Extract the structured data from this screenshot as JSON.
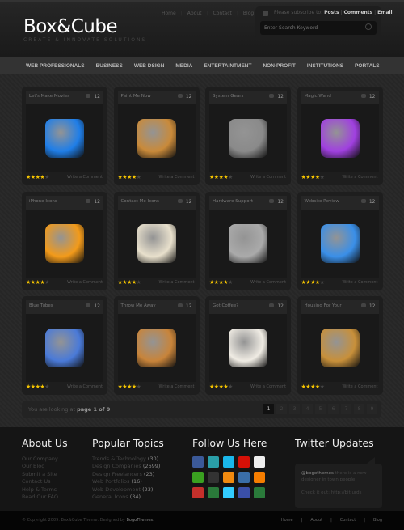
{
  "brand": {
    "name": "Box&Cube",
    "tagline": "CREATE & INNOVATE SOLUTIONS"
  },
  "top_links": [
    "Home",
    "About",
    "Contact",
    "Blog"
  ],
  "subscribe": {
    "text": "Please subscribe to:",
    "posts": "Posts",
    "comments": "Comments",
    "email": "Email",
    "icon": "rss-icon"
  },
  "search": {
    "placeholder": "Enter Search Keyword",
    "icon": "search-icon"
  },
  "nav": [
    "WEB PROFESSIONALS",
    "BUSINESS",
    "WEB DSIGN",
    "MEDIA",
    "ENTERTAINTMENT",
    "NON-PROFIT",
    "INSTITUTIONS",
    "PORTALS"
  ],
  "cards": [
    {
      "title": "Let's Make Movies",
      "comments": "12",
      "rating": 4,
      "link": "Write a Comment",
      "icon": "clapperboard-icon",
      "color": "#1f7ee8"
    },
    {
      "title": "Paint Me Now",
      "comments": "12",
      "rating": 4,
      "link": "Write a Comment",
      "icon": "paint-brush-icon",
      "color": "#c98a3a"
    },
    {
      "title": "System Gears",
      "comments": "12",
      "rating": 4,
      "link": "Write a Comment",
      "icon": "gear-icon",
      "color": "#8a8a8a"
    },
    {
      "title": "Magic Wand",
      "comments": "12",
      "rating": 4,
      "link": "Write a Comment",
      "icon": "magic-wand-icon",
      "color": "#a040e0"
    },
    {
      "title": "iPhone Icons",
      "comments": "12",
      "rating": 4,
      "link": "Write a Comment",
      "icon": "pen-tool-icon",
      "color": "#f29a1a"
    },
    {
      "title": "Contact Me Icons",
      "comments": "12",
      "rating": 4,
      "link": "Write a Comment",
      "icon": "envelope-pen-icon",
      "color": "#e8e0cc"
    },
    {
      "title": "Hardware Support",
      "comments": "12",
      "rating": 4,
      "link": "Write a Comment",
      "icon": "circuit-board-icon",
      "color": "#aaaaaa"
    },
    {
      "title": "Website Review",
      "comments": "12",
      "rating": 4,
      "link": "Write a Comment",
      "icon": "lens-icon",
      "color": "#3a8fe8"
    },
    {
      "title": "Blue Tubes",
      "comments": "12",
      "rating": 4,
      "link": "Write a Comment",
      "icon": "tv-icon",
      "color": "#4a7ad8"
    },
    {
      "title": "Throw Me Away",
      "comments": "12",
      "rating": 4,
      "link": "Write a Comment",
      "icon": "trash-box-icon",
      "color": "#c8843a"
    },
    {
      "title": "Got Coffee?",
      "comments": "12",
      "rating": 4,
      "link": "Write a Comment",
      "icon": "coffee-cup-icon",
      "color": "#f0ece4"
    },
    {
      "title": "Housing For Your",
      "comments": "12",
      "rating": 4,
      "link": "Write a Comment",
      "icon": "windmill-icon",
      "color": "#c8903a"
    }
  ],
  "pager": {
    "text": "You are looking at",
    "current": "page 1 of 9",
    "pages": [
      "1",
      "2",
      "3",
      "4",
      "5",
      "6",
      "7",
      "8",
      "9"
    ],
    "active": "1"
  },
  "footer": {
    "about": {
      "title": "About Us",
      "links": [
        "Our Company",
        "Our Blog",
        "Submit a Site",
        "Contact Us",
        "Help & Terms",
        "Read Our FAQ"
      ]
    },
    "topics": {
      "title": "Popular Topics",
      "items": [
        {
          "label": "Trends & Technology",
          "count": "(30)"
        },
        {
          "label": "Design Companies",
          "count": "(2699)"
        },
        {
          "label": "Design Freelancers",
          "count": "(23)"
        },
        {
          "label": "Web Portfolios",
          "count": "(16)"
        },
        {
          "label": "Web Development",
          "count": "(23)"
        },
        {
          "label": "General Icons",
          "count": "(34)"
        }
      ]
    },
    "follow": {
      "title": "Follow Us Here",
      "icons": [
        {
          "name": "facebook-icon",
          "color": "#3b5998"
        },
        {
          "name": "stumbleupon-icon",
          "color": "#2a9fa8"
        },
        {
          "name": "vimeo-icon",
          "color": "#1ab7ea"
        },
        {
          "name": "lastfm-icon",
          "color": "#d51007"
        },
        {
          "name": "flickr-icon",
          "color": "#eeeeee"
        },
        {
          "name": "chat-icon",
          "color": "#3aa020"
        },
        {
          "name": "delicious-icon",
          "color": "#333333"
        },
        {
          "name": "rss-feed-icon",
          "color": "#f08a10"
        },
        {
          "name": "digg-icon",
          "color": "#3a6ea8"
        },
        {
          "name": "blogger-icon",
          "color": "#f57d00"
        },
        {
          "name": "youtube-icon",
          "color": "#c4302b"
        },
        {
          "name": "tree-icon",
          "color": "#2a7a3a"
        },
        {
          "name": "twitter-icon",
          "color": "#33ccff"
        },
        {
          "name": "myspace-icon",
          "color": "#3a4fa8"
        },
        {
          "name": "share-icon",
          "color": "#2a7a3a"
        }
      ]
    },
    "twitter": {
      "title": "Twitter Updates",
      "handle": "@bogothemes",
      "tweet": "there is a new designer in town people!",
      "link": "Check it out: http://bit.urds"
    }
  },
  "bottom": {
    "copyright": "© Copyright 2009. Box&Cube Theme. Designed by",
    "designer": "BogoThemes",
    "links": [
      "Home",
      "About",
      "Contact",
      "Blog"
    ]
  }
}
